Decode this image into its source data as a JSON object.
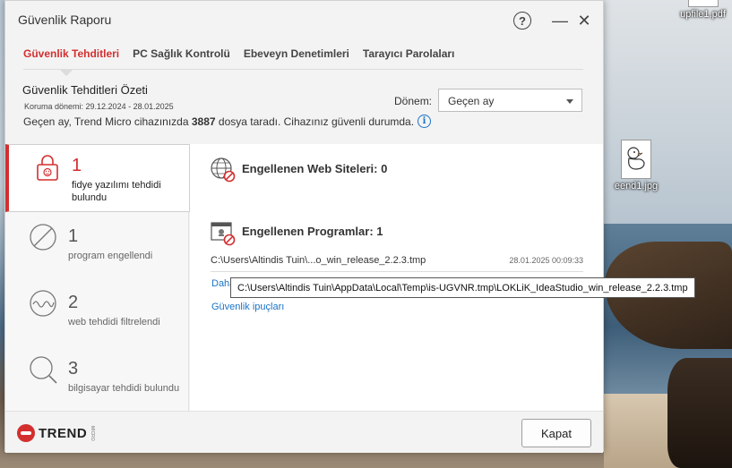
{
  "window": {
    "title": "Güvenlik Raporu",
    "help": "?",
    "minimize": "—",
    "close": "✕"
  },
  "tabs": [
    {
      "label": "Güvenlik Tehditleri",
      "active": true
    },
    {
      "label": "PC Sağlık Kontrolü",
      "active": false
    },
    {
      "label": "Ebeveyn Denetimleri",
      "active": false
    },
    {
      "label": "Tarayıcı Parolaları",
      "active": false
    }
  ],
  "summary": {
    "title": "Güvenlik Tehditleri Özeti",
    "period_range": "Koruma dönemi: 29.12.2024 - 28.01.2025",
    "scan_prefix": "Geçen ay, Trend Micro cihazınızda ",
    "scan_count": "3887",
    "scan_suffix": " dosya taradı. Cihazınız güvenli durumda.",
    "info_icon": "i",
    "period_label": "Dönem:",
    "period_value": "Geçen ay"
  },
  "stats": [
    {
      "count": "1",
      "label": "fidye yazılımı tehdidi bulundu",
      "icon": "lock-icon",
      "active": true
    },
    {
      "count": "1",
      "label": "program engellendi",
      "icon": "block-icon",
      "active": false
    },
    {
      "count": "2",
      "label": "web tehdidi filtrelendi",
      "icon": "wave-icon",
      "active": false
    },
    {
      "count": "3",
      "label": "bilgisayar tehdidi bulundu",
      "icon": "magnifier-icon",
      "active": false
    }
  ],
  "details": {
    "blocked_sites_title": "Engellenen Web Siteleri: 0",
    "blocked_programs_title": "Engellenen Programlar: 1",
    "program_path": "C:\\Users\\Altindis Tuin\\...o_win_release_2.2.3.tmp",
    "program_time": "28.01.2025 00:09:33",
    "more_link": "Daha",
    "tips_link": "Güvenlik ipuçları",
    "tooltip": "C:\\Users\\Altindis Tuin\\AppData\\Local\\Temp\\is-UGVNR.tmp\\LOKLiK_IdeaStudio_win_release_2.2.3.tmp"
  },
  "footer": {
    "brand": "TREND",
    "brand_small": "MICRO",
    "close_button": "Kapat"
  },
  "desktop": {
    "pdf_label": "upfile1.pdf",
    "jpg_label": "eend1.jpg"
  },
  "colors": {
    "accent": "#d32f2f",
    "link": "#1a73c8"
  }
}
